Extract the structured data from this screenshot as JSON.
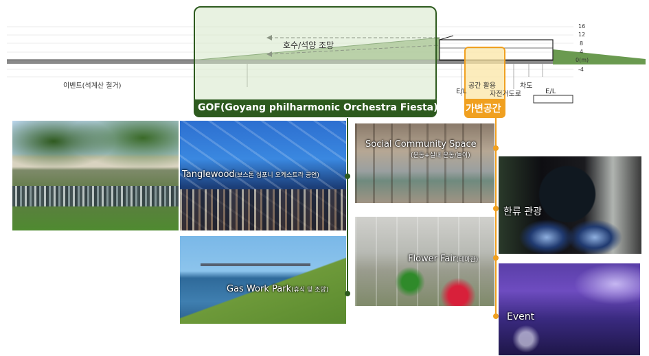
{
  "section": {
    "elevations": [
      "16",
      "12",
      "8",
      "4",
      "0(m)",
      "-4"
    ],
    "event_label": "이벤트(석계산 철거)",
    "view_label": "호수/석양 조망",
    "space_use_label": "공간 활용",
    "roadway_label": "차도",
    "bike_road_label": "자전거도로",
    "el_left": "E/L",
    "el_right": "E/L"
  },
  "gof_title": "GOF(Goyang philharmonic Orchestra Fiesta)",
  "variable_space_title": "가변공간",
  "photos": {
    "tanglewood": {
      "main": "Tanglewood",
      "sub": "(보스톤 심포니 오케스트라 공연)"
    },
    "gaswork": {
      "main": "Gas Work Park",
      "sub": "(휴식 및 조망)"
    },
    "social": {
      "main": "Social Community Space",
      "sub": "(운동+실내 운동/놀이)"
    },
    "flower": {
      "main": "Flower Fair",
      "sub": "(테마관)"
    },
    "hallyu": {
      "main": "한류 관광"
    },
    "event": {
      "main": "Event"
    }
  },
  "colors": {
    "green_dark": "#2d5a1e",
    "green_fill": "#e3eed8",
    "orange": "#f0a020",
    "orange_fill": "#fbe5a6"
  }
}
